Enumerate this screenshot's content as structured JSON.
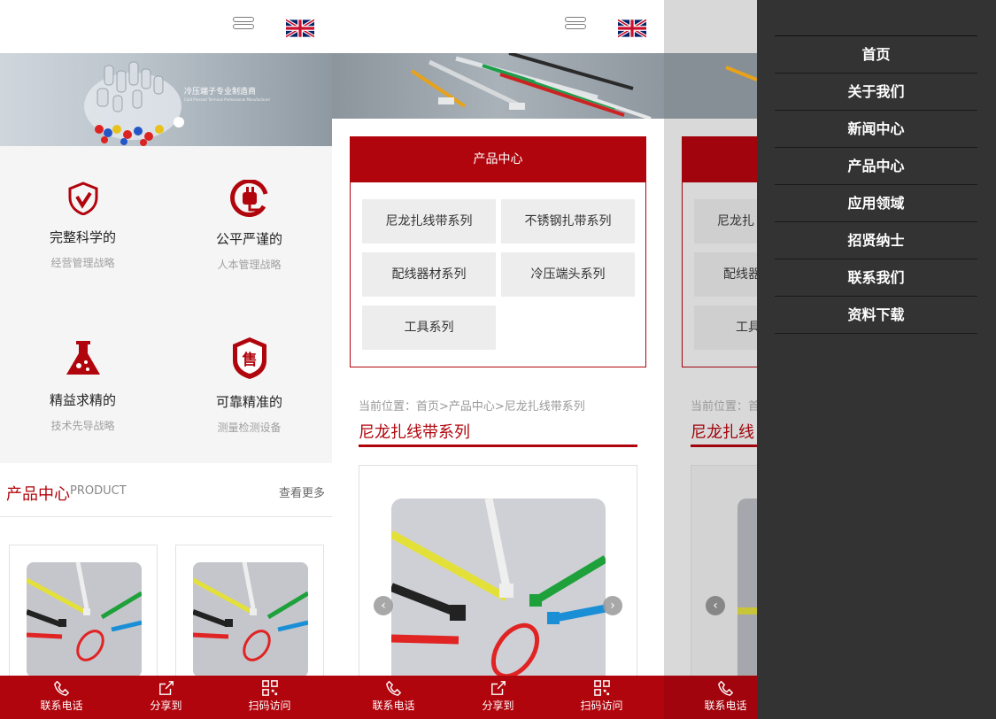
{
  "header": {
    "menu_icon": "hamburger-icon",
    "lang_icon": "uk-flag-icon"
  },
  "banner1": {
    "slogan": "冷压端子专业制造商",
    "subslogan": "Cold Pressed Terminal Professional Manufacturer"
  },
  "features": [
    {
      "icon": "shield-check-icon",
      "title": "完整科学的",
      "subtitle": "经营管理战略"
    },
    {
      "icon": "plug-e-icon",
      "title": "公平严谨的",
      "subtitle": "人本管理战略"
    },
    {
      "icon": "flask-icon",
      "title": "精益求精的",
      "subtitle": "技术先导战略"
    },
    {
      "icon": "sale-badge-icon",
      "title": "可靠精准的",
      "subtitle": "测量检测设备"
    }
  ],
  "products": {
    "title": "产品中心",
    "title_en": "PRODUCT",
    "more": "查看更多"
  },
  "category": {
    "title": "产品中心",
    "items": [
      "尼龙扎线带系列",
      "不锈钢扎带系列",
      "配线器材系列",
      "冷压端头系列",
      "工具系列"
    ],
    "items_partial": [
      "尼龙扎",
      "配线器",
      "工具"
    ]
  },
  "breadcrumb": "当前位置：首页>产品中心>尼龙扎线带系列",
  "breadcrumb_partial": "当前位置：首",
  "section_title": "尼龙扎线带系列",
  "section_title_partial": "尼龙扎线",
  "bottom_bar": [
    {
      "icon": "phone-icon",
      "label": "联系电话"
    },
    {
      "icon": "share-icon",
      "label": "分享到"
    },
    {
      "icon": "qrcode-icon",
      "label": "扫码访问"
    }
  ],
  "menu": [
    "首页",
    "关于我们",
    "新闻中心",
    "产品中心",
    "应用领域",
    "招贤纳士",
    "联系我们",
    "资料下载"
  ],
  "colors": {
    "brand_red": "#b1050d",
    "menu_bg": "#333333"
  }
}
